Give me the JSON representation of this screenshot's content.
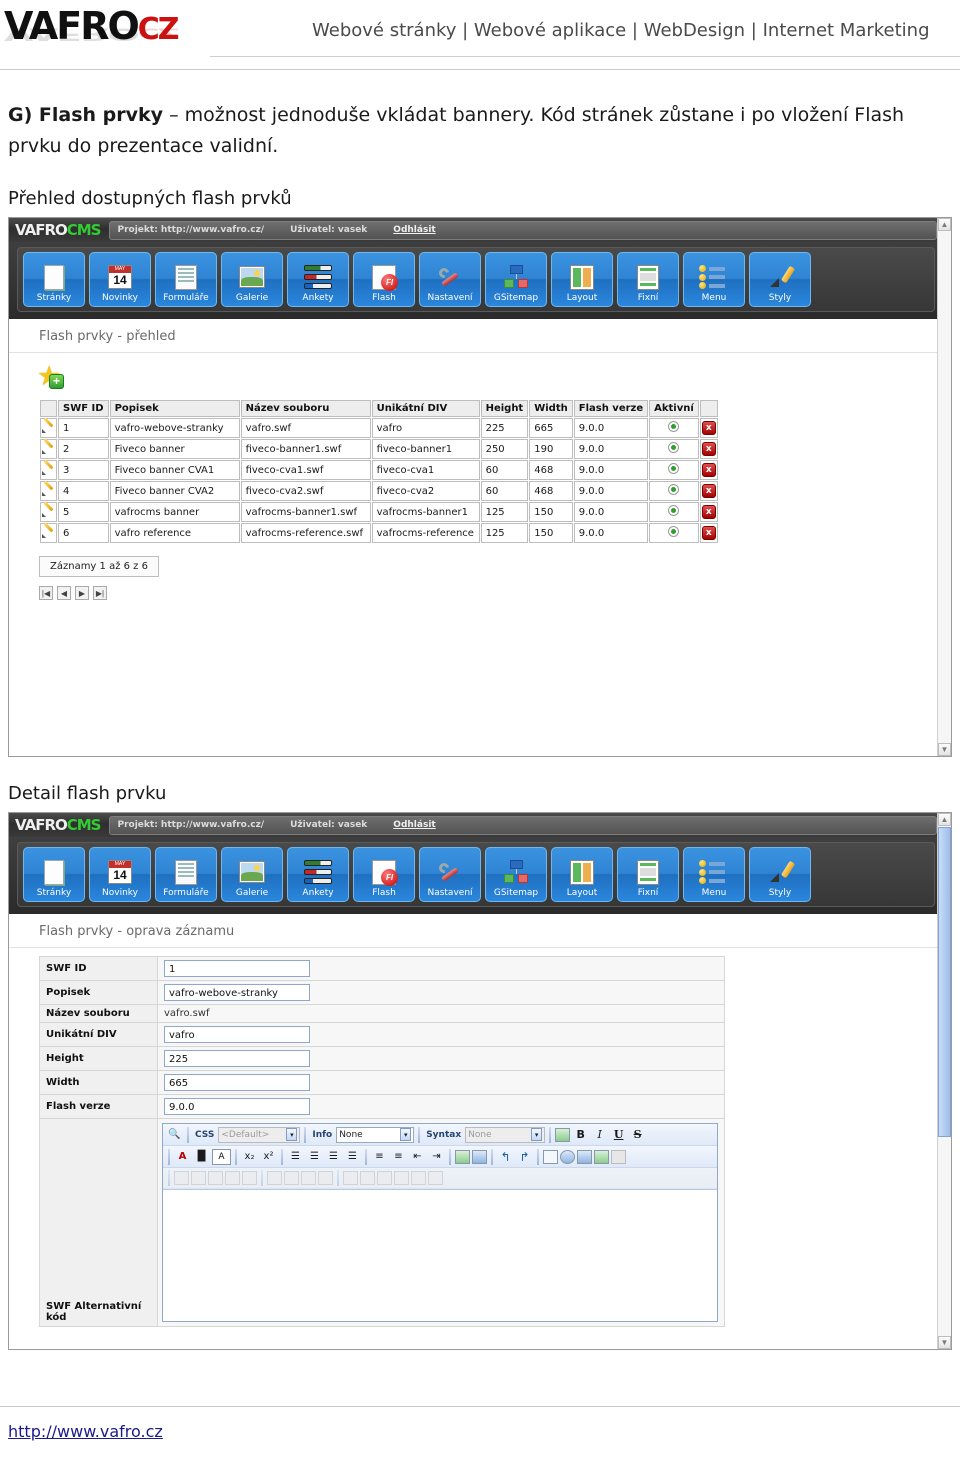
{
  "header": {
    "logo_main": "VAFRO",
    "logo_suffix": "CZ",
    "tagline": "Webové stránky | Webové aplikace | WebDesign | Internet Marketing"
  },
  "document": {
    "paragraph_lead": "G) Flash prvky",
    "paragraph_rest": " – možnost jednoduše vkládat bannery. Kód stránek zůstane i po vložení Flash prvku do prezentace validní.",
    "subhead_1": "Přehled dostupných flash prvků",
    "subhead_2": "Detail flash prvku"
  },
  "cms": {
    "logo_vafro": "VAFRO",
    "logo_cms": "CMS",
    "project_label": "Projekt: http://www.vafro.cz/",
    "user_label": "Uživatel: vasek",
    "logout_label": "Odhlásit",
    "menu": [
      {
        "label": "Stránky",
        "icon": "page-icon"
      },
      {
        "label": "Novinky",
        "icon": "calendar-icon"
      },
      {
        "label": "Formuláře",
        "icon": "form-icon"
      },
      {
        "label": "Galerie",
        "icon": "gallery-icon"
      },
      {
        "label": "Ankety",
        "icon": "poll-icon"
      },
      {
        "label": "Flash",
        "icon": "flash-icon"
      },
      {
        "label": "Nastavení",
        "icon": "wrench-icon"
      },
      {
        "label": "GSitemap",
        "icon": "sitemap-icon"
      },
      {
        "label": "Layout",
        "icon": "layout-icon"
      },
      {
        "label": "Fixní",
        "icon": "fixed-layout-icon"
      },
      {
        "label": "Menu",
        "icon": "menu-list-icon"
      },
      {
        "label": "Styly",
        "icon": "brush-icon"
      }
    ],
    "calendar_month": "MAY",
    "calendar_day": "14",
    "flash_badge": "Fl"
  },
  "overview": {
    "panel_title": "Flash prvky - přehled",
    "add_icon": "star-add-icon",
    "columns": [
      "",
      "SWF ID",
      "Popisek",
      "Název souboru",
      "Unikátní DIV",
      "Height",
      "Width",
      "Flash verze",
      "Aktivní",
      ""
    ],
    "rows": [
      {
        "swf_id": "1",
        "popisek": "vafro-webove-stranky",
        "soubor": "vafro.swf",
        "div": "vafro",
        "height": "225",
        "width": "665",
        "verze": "9.0.0",
        "aktivni": "on"
      },
      {
        "swf_id": "2",
        "popisek": "Fiveco banner",
        "soubor": "fiveco-banner1.swf",
        "div": "fiveco-banner1",
        "height": "250",
        "width": "190",
        "verze": "9.0.0",
        "aktivni": "on"
      },
      {
        "swf_id": "3",
        "popisek": "Fiveco banner CVA1",
        "soubor": "fiveco-cva1.swf",
        "div": "fiveco-cva1",
        "height": "60",
        "width": "468",
        "verze": "9.0.0",
        "aktivni": "on"
      },
      {
        "swf_id": "4",
        "popisek": "Fiveco banner CVA2",
        "soubor": "fiveco-cva2.swf",
        "div": "fiveco-cva2",
        "height": "60",
        "width": "468",
        "verze": "9.0.0",
        "aktivni": "on"
      },
      {
        "swf_id": "5",
        "popisek": "vafrocms banner",
        "soubor": "vafrocms-banner1.swf",
        "div": "vafrocms-banner1",
        "height": "125",
        "width": "150",
        "verze": "9.0.0",
        "aktivni": "on"
      },
      {
        "swf_id": "6",
        "popisek": "vafro reference",
        "soubor": "vafrocms-reference.swf",
        "div": "vafrocms-reference",
        "height": "125",
        "width": "150",
        "verze": "9.0.0",
        "aktivni": "on"
      }
    ],
    "records_label": "Záznamy 1 až 6 z 6",
    "pager": [
      "|◀",
      "◀",
      "▶",
      "▶|"
    ]
  },
  "detail": {
    "panel_title": "Flash prvky - oprava záznamu",
    "fields": [
      {
        "label": "SWF ID",
        "value": "1",
        "editable": true
      },
      {
        "label": "Popisek",
        "value": "vafro-webove-stranky",
        "editable": true
      },
      {
        "label": "Název souboru",
        "value": "vafro.swf",
        "editable": false
      },
      {
        "label": "Unikátní DIV",
        "value": "vafro",
        "editable": true
      },
      {
        "label": "Height",
        "value": "225",
        "editable": true
      },
      {
        "label": "Width",
        "value": "665",
        "editable": true
      },
      {
        "label": "Flash verze",
        "value": "9.0.0",
        "editable": true
      }
    ],
    "alt_code_label": "SWF Alternativní kód"
  },
  "editor": {
    "search_icon": "magnifier-icon",
    "css_label": "CSS",
    "css_value": "<Default>",
    "info_label": "Info",
    "info_value": "None",
    "syntax_label": "Syntax",
    "syntax_value": "None",
    "bold": "B",
    "italic": "I",
    "underline": "U",
    "strike": "S",
    "subscript": "x₂",
    "superscript": "x²",
    "undo": "↰",
    "redo": "↱"
  },
  "footer": {
    "url": "http://www.vafro.cz"
  },
  "colors": {
    "brand_red": "#cc1111",
    "cms_green": "#33cc33",
    "button_blue": "#2f84d4",
    "link_blue": "#1a1a8c",
    "status_green": "#2e9e2e",
    "delete_red": "#a40000"
  }
}
